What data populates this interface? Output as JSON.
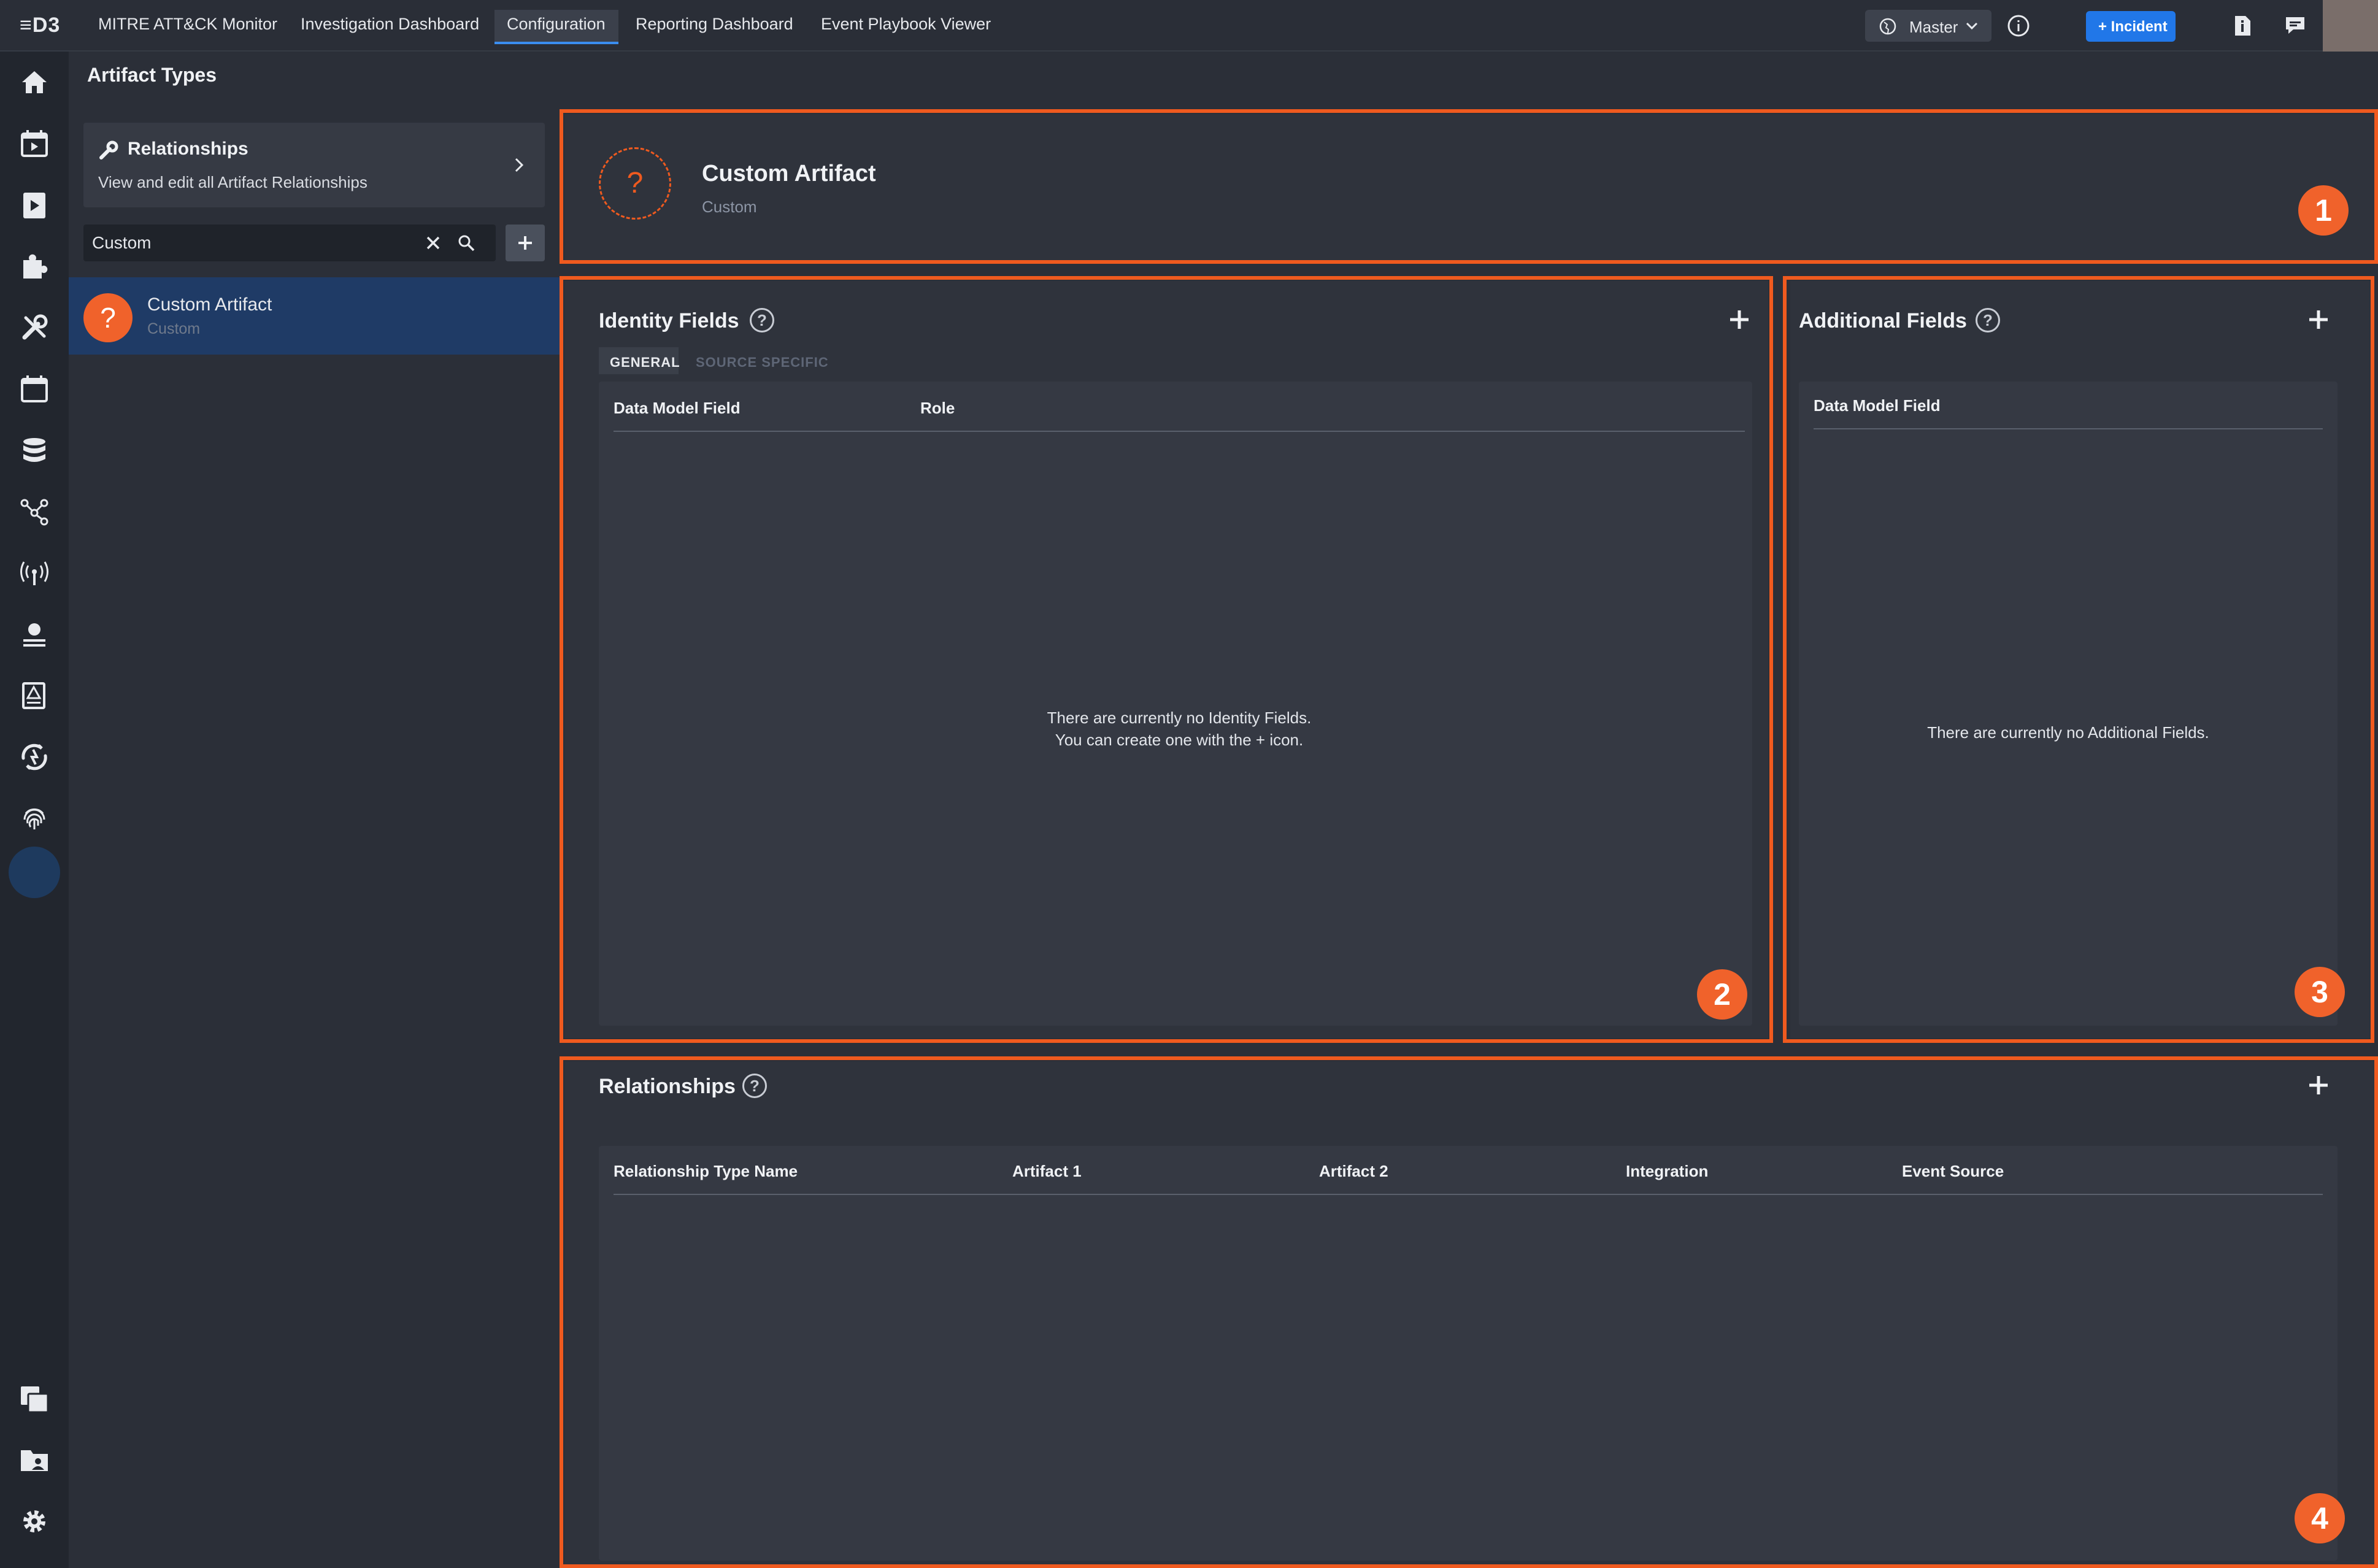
{
  "topbar": {
    "logo": "≡D3",
    "nav": [
      "MITRE ATT&CK Monitor",
      "Investigation Dashboard",
      "Configuration",
      "Reporting Dashboard",
      "Event Playbook Viewer"
    ],
    "master_label": "Master",
    "incident_label": "+ Incident"
  },
  "sidebar": {
    "page_title": "Artifact Types",
    "relationships_card": {
      "title": "Relationships",
      "subtitle": "View and edit all Artifact Relationships"
    },
    "search": {
      "value": "Custom"
    },
    "list": [
      {
        "name": "Custom Artifact",
        "sub": "Custom",
        "icon": "?"
      }
    ]
  },
  "header": {
    "title": "Custom Artifact",
    "subtitle": "Custom",
    "icon": "?",
    "badge": "1"
  },
  "identity": {
    "title": "Identity Fields",
    "tabs": [
      "GENERAL",
      "SOURCE SPECIFIC"
    ],
    "columns": [
      "Data Model Field",
      "Role"
    ],
    "empty_line1": "There are currently no Identity Fields.",
    "empty_line2": "You can create one with the + icon.",
    "badge": "2"
  },
  "additional": {
    "title": "Additional Fields",
    "columns": [
      "Data Model Field"
    ],
    "empty": "There are currently no Additional Fields.",
    "badge": "3"
  },
  "relationships": {
    "title": "Relationships",
    "columns": [
      "Relationship Type Name",
      "Artifact 1",
      "Artifact 2",
      "Integration",
      "Event Source"
    ],
    "badge": "4"
  },
  "colors": {
    "accent": "#ef5a1f",
    "primary": "#2177e8",
    "selected": "#1f3b66"
  }
}
